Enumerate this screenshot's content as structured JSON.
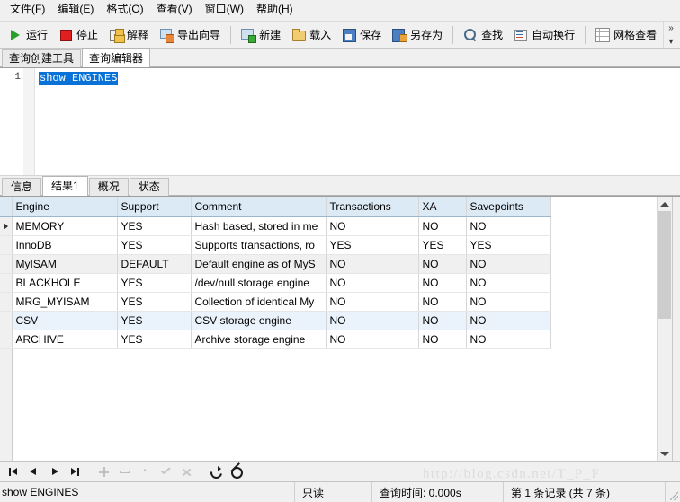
{
  "menubar": {
    "items": [
      {
        "label": "文件(F)",
        "mnemonic": "F"
      },
      {
        "label": "编辑(E)",
        "mnemonic": "E"
      },
      {
        "label": "格式(O)",
        "mnemonic": "O"
      },
      {
        "label": "查看(V)",
        "mnemonic": "V"
      },
      {
        "label": "窗口(W)",
        "mnemonic": "W"
      },
      {
        "label": "帮助(H)",
        "mnemonic": "H"
      }
    ]
  },
  "toolbar": {
    "run_label": "运行",
    "stop_label": "停止",
    "explain_label": "解释",
    "export_label": "导出向导",
    "new_label": "新建",
    "open_label": "载入",
    "save_label": "保存",
    "saveas_label": "另存为",
    "find_label": "查找",
    "wrap_label": "自动换行",
    "grid_label": "网格查看",
    "overflow_label": "»",
    "overflow_more": "▾"
  },
  "top_tabs": [
    {
      "label": "查询创建工具",
      "active": false
    },
    {
      "label": "查询编辑器",
      "active": true
    }
  ],
  "editor": {
    "line_number": "1",
    "sql_text": "show ENGINES",
    "selection_color": "#0a72d6"
  },
  "result_tabs": [
    {
      "label": "信息",
      "active": false
    },
    {
      "label": "结果1",
      "active": true
    },
    {
      "label": "概况",
      "active": false
    },
    {
      "label": "状态",
      "active": false
    }
  ],
  "grid": {
    "columns": [
      "Engine",
      "Support",
      "Comment",
      "Transactions",
      "XA",
      "Savepoints"
    ],
    "rows": [
      {
        "current": true,
        "engine": "MEMORY",
        "support": "YES",
        "comment": "Hash based, stored in me",
        "transactions": "NO",
        "xa": "NO",
        "savepoints": "NO"
      },
      {
        "current": false,
        "engine": "InnoDB",
        "support": "YES",
        "comment": "Supports transactions, ro",
        "transactions": "YES",
        "xa": "YES",
        "savepoints": "YES"
      },
      {
        "current": false,
        "engine": "MyISAM",
        "support": "DEFAULT",
        "comment": "Default engine as of MyS",
        "transactions": "NO",
        "xa": "NO",
        "savepoints": "NO"
      },
      {
        "current": false,
        "engine": "BLACKHOLE",
        "support": "YES",
        "comment": "/dev/null storage engine",
        "transactions": "NO",
        "xa": "NO",
        "savepoints": "NO"
      },
      {
        "current": false,
        "engine": "MRG_MYISAM",
        "support": "YES",
        "comment": "Collection of identical My",
        "transactions": "NO",
        "xa": "NO",
        "savepoints": "NO"
      },
      {
        "current": false,
        "engine": "CSV",
        "support": "YES",
        "comment": "CSV storage engine",
        "transactions": "NO",
        "xa": "NO",
        "savepoints": "NO"
      },
      {
        "current": false,
        "engine": "ARCHIVE",
        "support": "YES",
        "comment": "Archive storage engine",
        "transactions": "NO",
        "xa": "NO",
        "savepoints": "NO"
      }
    ],
    "header_bg": "#dceaf6",
    "alt_row_bg": "#f0f0f0",
    "selected_row_bg": "#eaf3fb"
  },
  "navbar": {
    "buttons": [
      {
        "name": "first-record",
        "glyph": "first",
        "enabled": true
      },
      {
        "name": "prev-record",
        "glyph": "prev",
        "enabled": true
      },
      {
        "name": "next-record",
        "glyph": "next",
        "enabled": true
      },
      {
        "name": "last-record",
        "glyph": "last",
        "enabled": true
      },
      {
        "name": "add-record",
        "glyph": "add",
        "enabled": false
      },
      {
        "name": "delete-record",
        "glyph": "del",
        "enabled": false
      },
      {
        "name": "edit-record",
        "glyph": "edit",
        "enabled": false
      },
      {
        "name": "apply-changes",
        "glyph": "ok",
        "enabled": false
      },
      {
        "name": "cancel-changes",
        "glyph": "cancel",
        "enabled": false
      },
      {
        "name": "refresh",
        "glyph": "refresh",
        "enabled": true
      },
      {
        "name": "stop-loading",
        "glyph": "stop",
        "enabled": true
      }
    ]
  },
  "statusbar": {
    "sql": "show ENGINES",
    "readonly": "只读",
    "query_time": "查询时间: 0.000s",
    "record_info": "第 1 条记录 (共 7 条)"
  },
  "watermark": {
    "text": "http://blog.csdn.net/T_P_F"
  }
}
